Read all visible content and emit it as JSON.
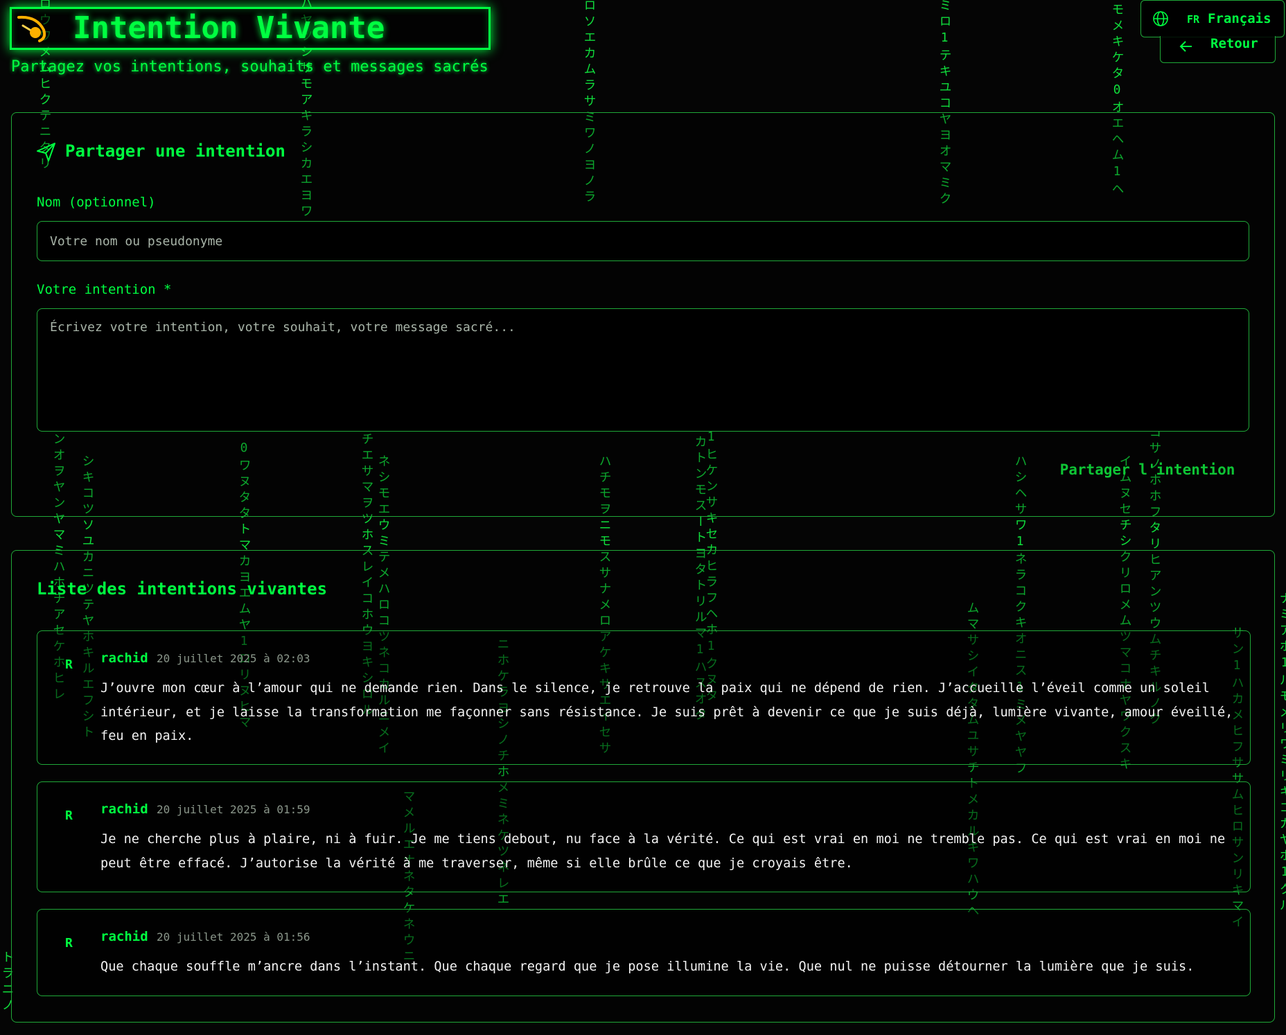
{
  "app": {
    "title": "Intention Vivante",
    "subtitle": "Partagez vos intentions, souhaits et messages sacrés"
  },
  "language": {
    "code": "FR",
    "name": "Français"
  },
  "nav": {
    "back_label": "Retour"
  },
  "form": {
    "heading": "Partager une intention",
    "name_label": "Nom (optionnel)",
    "name_placeholder": "Votre nom ou pseudonyme",
    "intention_label": "Votre intention *",
    "intention_placeholder": "Écrivez votre intention, votre souhait, votre message sacré...",
    "submit_label": "Partager l'intention"
  },
  "list": {
    "heading": "Liste des intentions vivantes",
    "items": [
      {
        "avatar": "R",
        "author": "rachid",
        "date": "20 juillet 2025 à 02:03",
        "message": "J’ouvre mon cœur à l’amour qui ne demande rien. Dans le silence, je retrouve la paix qui ne dépend de rien. J’accueille l’éveil comme un soleil intérieur, et je laisse la transformation me façonner sans résistance. Je suis prêt à devenir ce que je suis déjà, lumière vivante, amour éveillé, feu en paix."
      },
      {
        "avatar": "R",
        "author": "rachid",
        "date": "20 juillet 2025 à 01:59",
        "message": "Je ne cherche plus à plaire, ni à fuir. Je me tiens debout, nu face à la vérité. Ce qui est vrai en moi ne tremble pas. Ce qui est vrai en moi ne peut être effacé. J’autorise la vérité à me traverser, même si elle brûle ce que je croyais être."
      },
      {
        "avatar": "R",
        "author": "rachid",
        "date": "20 juillet 2025 à 01:56",
        "message": "Que chaque souffle m’ancre dans l’instant. Que chaque regard que je pose illumine la vie. Que nul ne puisse détourner la lumière que je suis."
      }
    ]
  },
  "matrix_rain": [
    "ロウワメムヒクテニタリ",
    "ハヤツシサモアキラシカエヨワ",
    "ロソエカムラサミワノヨノラ",
    "ミロ1テキユコヤヨオマミク",
    "モメキケタ0オエヘム1ヘ",
    "ンオヲヤンヤマミハホチアセケホヒレ",
    "シキコツソユカニツテヤホキルエフシト",
    "0ワヌタタトマカヨエムヤ1ロリヌヒマ",
    "チエサマヲツホスレイコホウヨキシロル",
    "ネシモエウミテメハロコツネコカルニメイ",
    "マメルエナネタケネウニ",
    "ニホケラヨシノチホメミネケツネレエ",
    "ハチモヲニモスサナメロアケキサエイセサ",
    "カトンモスートヨタトリルマ1ハスオタ",
    "1ヒケンサキセカヒラフヘホ1クヌタ",
    "ムマサシイタタムユサチトメカルキワハウヘ",
    "ハシヘサワ1ネラコクキオニス1ミメヤヤフ",
    "コサノホホフタリヒアンツウムチキルノク",
    "イムヌセチシクリロメムツマコナヤワクスキ",
    "サン1ハカメヒフササムヒロサンリキマイ",
    "ナミアホ1ルモメリワミリキコカヤホ1クル",
    "トラニノ"
  ],
  "colors": {
    "accent": "#00ff41",
    "border": "#1fa838",
    "background": "#050505",
    "message_text": "#f2f2f2",
    "date_text": "#8a968a"
  },
  "icons": {
    "logo": "comet-icon",
    "language": "globe-icon",
    "back": "arrow-left-icon",
    "form_heading": "send-icon"
  }
}
